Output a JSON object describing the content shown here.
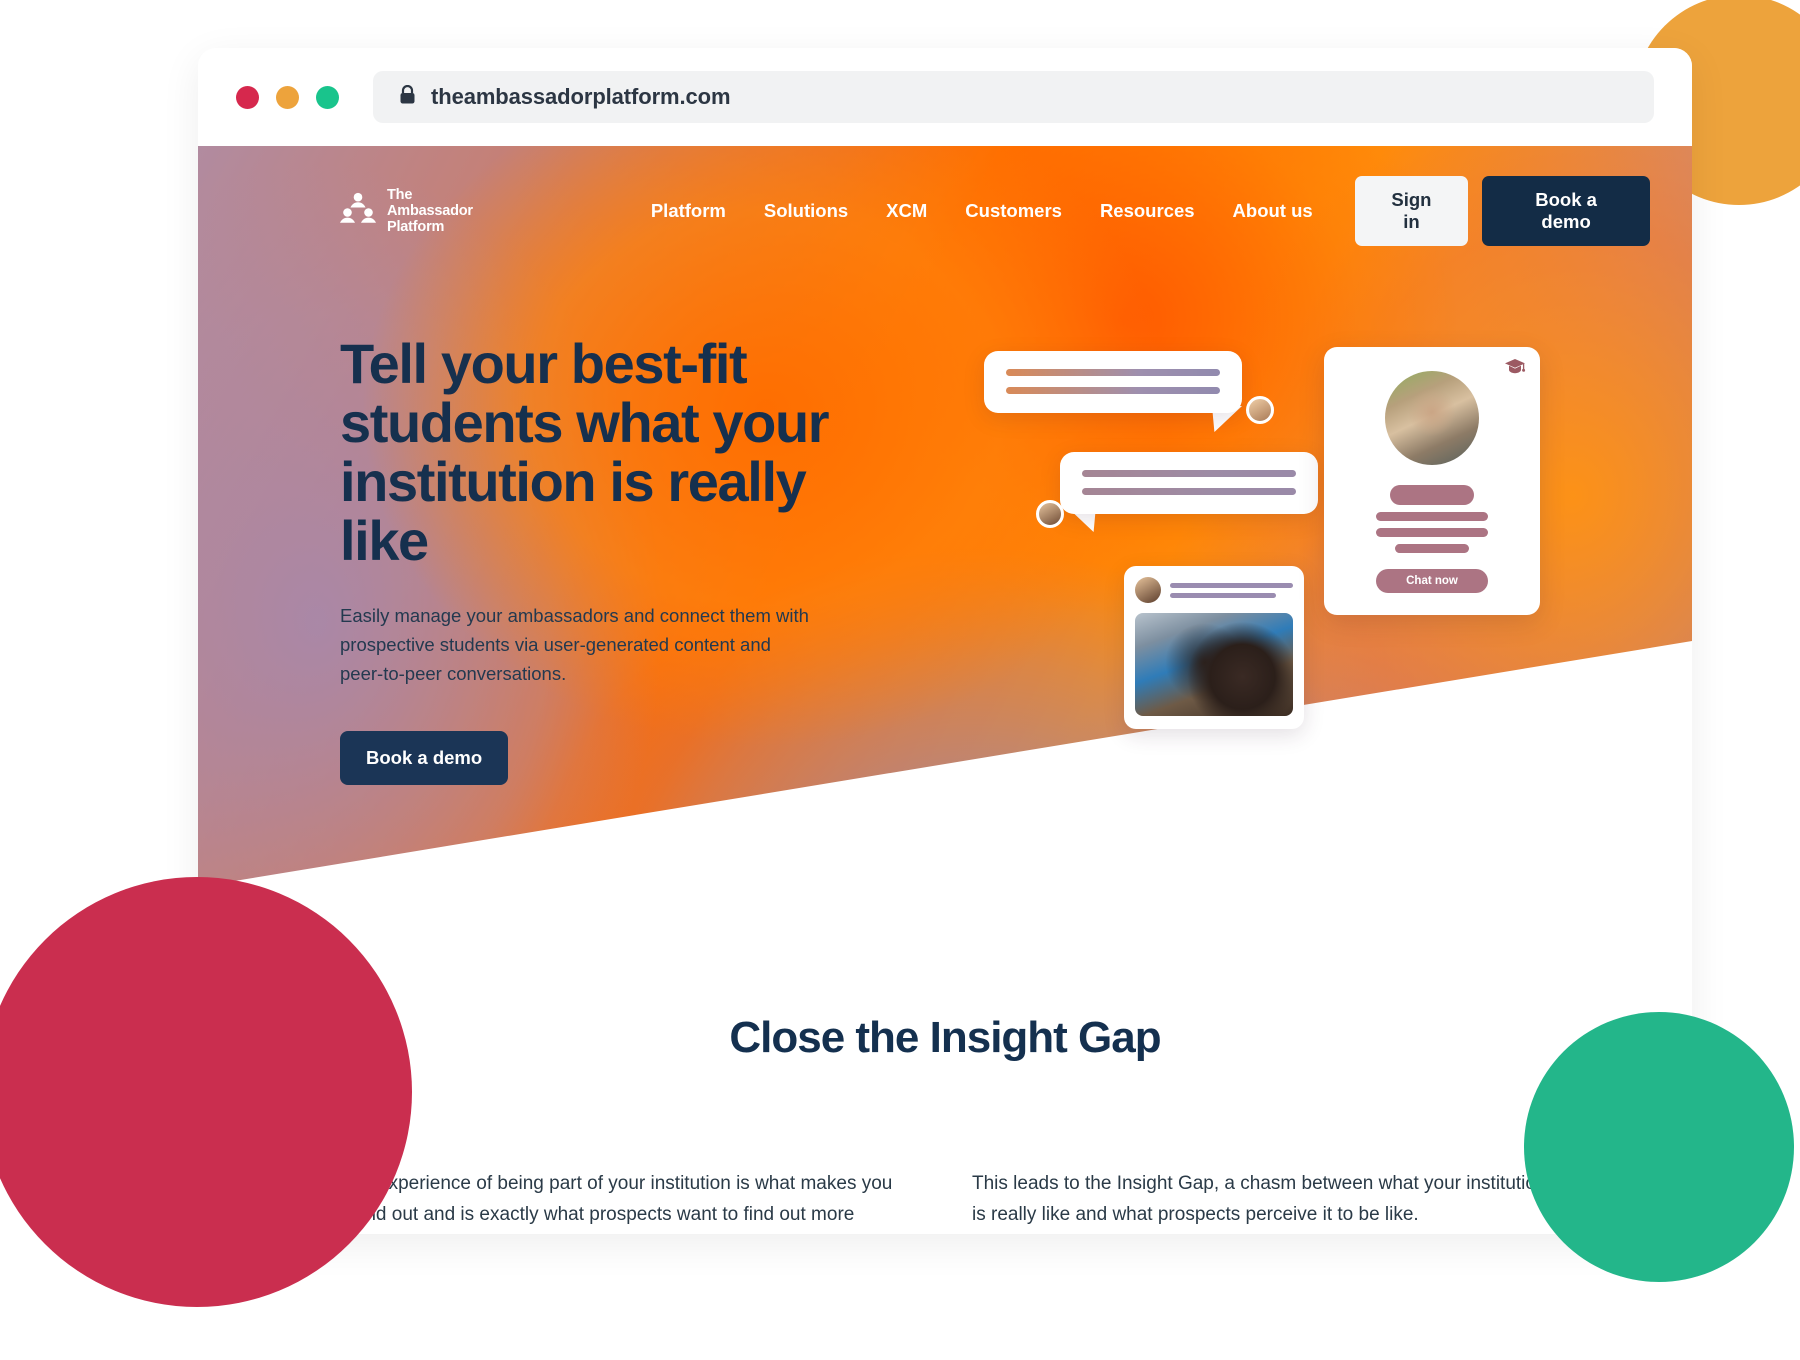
{
  "browser": {
    "url": "theambassadorplatform.com",
    "lock_icon": "lock-icon",
    "traffic_lights": [
      "close-red",
      "minimize-amber",
      "maximize-green"
    ]
  },
  "site": {
    "logo": {
      "icon": "ambassador-people-logo-icon",
      "line1": "The",
      "line2": "Ambassador",
      "line3": "Platform"
    },
    "nav": {
      "links": [
        {
          "label": "Platform"
        },
        {
          "label": "Solutions"
        },
        {
          "label": "XCM"
        },
        {
          "label": "Customers"
        },
        {
          "label": "Resources"
        },
        {
          "label": "About us"
        }
      ],
      "sign_in": "Sign in",
      "book_demo": "Book a demo"
    },
    "hero": {
      "title": "Tell your best-fit students what your institution is really like",
      "subtitle": "Easily manage your ambassadors and connect them with prospective students via user-generated content and peer-to-peer conversations.",
      "cta": "Book a demo",
      "illustration": {
        "profile_card": {
          "cap_icon": "graduation-cap-icon",
          "chat_button": "Chat now"
        }
      }
    },
    "insight": {
      "title": "Close the Insight Gap",
      "paragraph_left": "The experience of being part of your institution is what makes you stand out and is exactly what prospects want to find out more",
      "paragraph_right": "This leads to the Insight Gap, a chasm between what your institution is really like and what prospects perceive it to be like."
    },
    "colors": {
      "navy": "#16304e",
      "cta_navy": "#1b3556",
      "orange": "#ff6a00",
      "amber": "#eda33c",
      "crimson": "#ca2e4f",
      "teal": "#23b68a",
      "mauve": "#ac7483"
    }
  }
}
